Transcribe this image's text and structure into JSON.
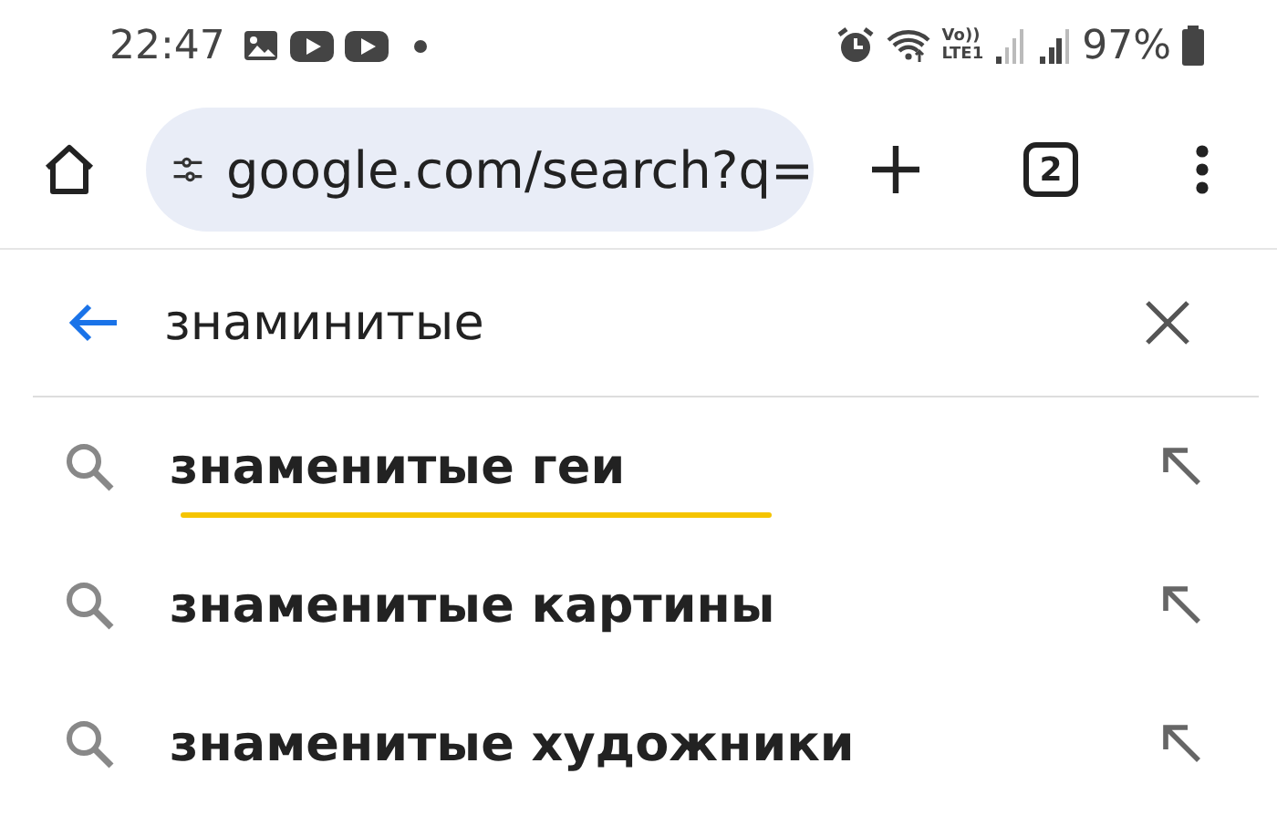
{
  "status_bar": {
    "time": "22:47",
    "volte": "Vo))",
    "lte": "LTE1",
    "battery": "97%"
  },
  "toolbar": {
    "url": "google.com/search?q=",
    "tab_count": "2"
  },
  "search": {
    "value": "знаминитые"
  },
  "suggestions": [
    {
      "text": "знаменитые геи",
      "underlined": true
    },
    {
      "text": "знаменитые картины",
      "underlined": false
    },
    {
      "text": "знаменитые художники",
      "underlined": false
    }
  ]
}
